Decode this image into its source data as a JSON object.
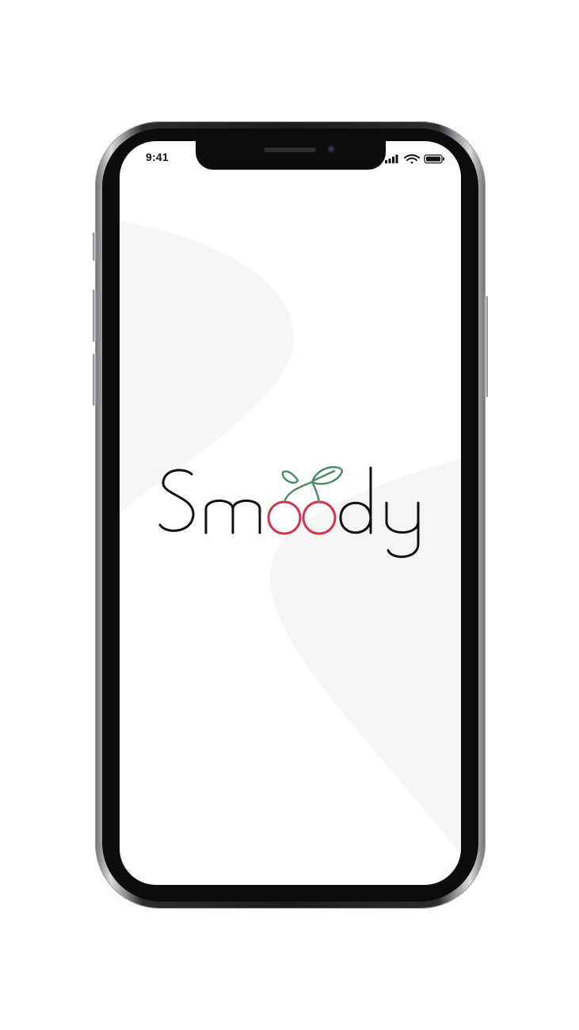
{
  "status_bar": {
    "time": "9:41",
    "icons": [
      "cellular-signal-icon",
      "wifi-icon",
      "battery-icon"
    ]
  },
  "splash": {
    "logo_text": "Smoody",
    "logo_icon": "cherry-leaf-icon"
  },
  "colors": {
    "text_dark": "#111111",
    "cherry_red": "#d1344a",
    "leaf_green": "#4f8b68",
    "screen_bg": "#ffffff",
    "wave_gray": "#f6f6f6"
  }
}
